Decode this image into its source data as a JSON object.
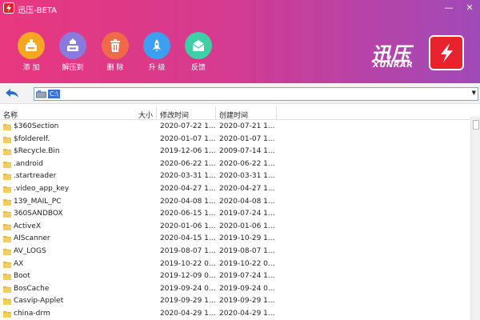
{
  "window": {
    "title": "迅压-BETA",
    "min_glyph": "—",
    "close_glyph": "✕"
  },
  "toolbar": {
    "items": [
      {
        "label": "添 加",
        "icon": "add-archive-icon",
        "color": "#f5a623"
      },
      {
        "label": "解压到",
        "icon": "extract-icon",
        "color": "#8a7ae0"
      },
      {
        "label": "删 除",
        "icon": "trash-icon",
        "color": "#f06a4a"
      },
      {
        "label": "升 级",
        "icon": "rocket-icon",
        "color": "#3d9ff0"
      },
      {
        "label": "反馈",
        "icon": "mail-icon",
        "color": "#3fcfa6"
      }
    ]
  },
  "brand": {
    "cn": "迅压",
    "en": "XUNRAR",
    "color": "#e8232f"
  },
  "address": {
    "path": "C:\\"
  },
  "columns": {
    "name": "名称",
    "size": "大小",
    "modified": "修改时间",
    "created": "创建时间"
  },
  "files": [
    {
      "name": "$360Section",
      "modified": "2020-07-22 1...",
      "created": "2020-07-21 1..."
    },
    {
      "name": "$folderelf.",
      "modified": "2020-01-07 1...",
      "created": "2020-01-07 1..."
    },
    {
      "name": "$Recycle.Bin",
      "modified": "2019-12-06 1...",
      "created": "2009-07-14 1..."
    },
    {
      "name": ".android",
      "modified": "2020-06-22 1...",
      "created": "2020-06-22 1..."
    },
    {
      "name": ".startreader",
      "modified": "2020-03-31 1...",
      "created": "2020-03-31 1..."
    },
    {
      "name": ".video_app_key",
      "modified": "2020-04-27 1...",
      "created": "2020-04-27 1..."
    },
    {
      "name": "139_MAIL_PC",
      "modified": "2020-04-08 1...",
      "created": "2020-04-08 1..."
    },
    {
      "name": "360SANDBOX",
      "modified": "2020-06-15 1...",
      "created": "2019-07-24 1..."
    },
    {
      "name": "ActiveX",
      "modified": "2020-01-06 1...",
      "created": "2020-01-06 1..."
    },
    {
      "name": "AIScanner",
      "modified": "2020-04-15 1...",
      "created": "2019-10-29 1..."
    },
    {
      "name": "AV_LOGS",
      "modified": "2019-08-07 1...",
      "created": "2019-08-07 1..."
    },
    {
      "name": "AX",
      "modified": "2019-10-22 0...",
      "created": "2019-10-22 0..."
    },
    {
      "name": "Boot",
      "modified": "2019-12-09 0...",
      "created": "2019-07-24 1..."
    },
    {
      "name": "BosCache",
      "modified": "2019-09-24 0...",
      "created": "2019-09-24 0..."
    },
    {
      "name": "Casvip-Applet",
      "modified": "2019-09-29 1...",
      "created": "2019-09-29 1..."
    },
    {
      "name": "china-drm",
      "modified": "2020-04-29 1...",
      "created": "2020-04-29 1..."
    }
  ],
  "colors": {
    "header_start": "#e8387f",
    "header_end": "#a04ab8",
    "folder": "#e8b94a",
    "selection": "#3b6fd4"
  }
}
